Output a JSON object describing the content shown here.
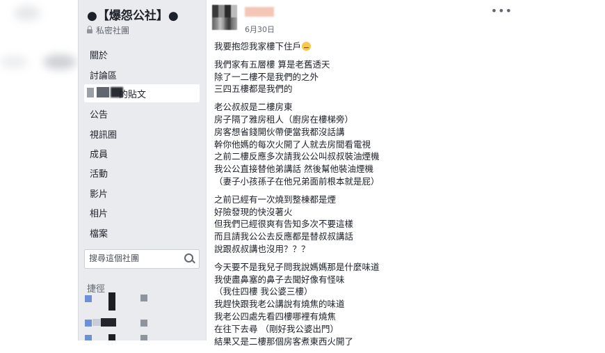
{
  "group": {
    "title": "●【爆怨公社】●",
    "privacy": "私密社團"
  },
  "nav": {
    "items": [
      "關於",
      "討論區",
      "的貼文",
      "公告",
      "視訊圈",
      "成員",
      "活動",
      "影片",
      "相片",
      "檔案"
    ]
  },
  "search": {
    "placeholder": "搜尋這個社團"
  },
  "shortcuts": {
    "title": "捷徑"
  },
  "post": {
    "date": "6月30日",
    "more_label": "•••",
    "paragraphs": [
      [
        "我要抱怨我家樓下住戶"
      ],
      [
        "我們家有五層樓 算是老舊透天",
        "除了一二樓不是我們的之外",
        "三四五樓都是我們的"
      ],
      [
        "老公叔叔是二樓房東",
        "房子隔了雅房租人（廚房在樓梯旁）",
        "房客想省錢開伙帶便當我都沒話講",
        "幹你他媽的每次火開了人就去房間看電視",
        "之前二樓反應多次請我公公叫叔叔裝油煙機",
        "我公公直接替他弟講話 然後幫他裝油煙機",
        "（妻子小孩孫子在他兄弟面前根本就是屁）"
      ],
      [
        "之前已經有一次燒到整棟都是煙",
        "好險發現的快沒著火",
        "但我們已經很爽有告知多次不要這樣",
        "而且請我公公去反應都是替叔叔講話",
        "說跟叔叔講也沒用？？？"
      ],
      [
        "今天要不是我兒子問我說媽媽那是什麼味道",
        "我使盡鼻塞的鼻子去聞好像有怪味",
        "（我住四樓 我公婆三樓）",
        "我趕快跟我老公講說有燒焦的味道",
        "我老公四處先看四樓哪裡有燒焦",
        "在往下去尋 （剛好我公婆出門）",
        "結果又是二樓那個房客煮東西火開了"
      ]
    ]
  }
}
